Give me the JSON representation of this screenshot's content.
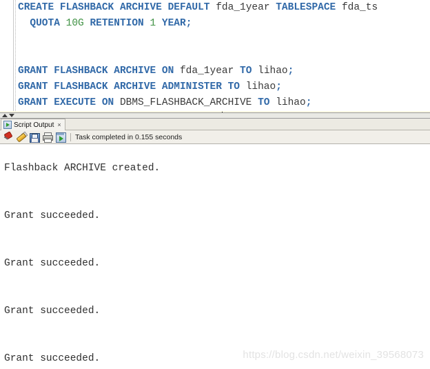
{
  "editor": {
    "lines": [
      {
        "current": false,
        "tokens": [
          {
            "t": "CREATE",
            "k": "kw"
          },
          {
            "t": " ",
            "k": "ws"
          },
          {
            "t": "FLASHBACK",
            "k": "kw"
          },
          {
            "t": " ",
            "k": "ws"
          },
          {
            "t": "ARCHIVE",
            "k": "kw"
          },
          {
            "t": " ",
            "k": "ws"
          },
          {
            "t": "DEFAULT",
            "k": "kw"
          },
          {
            "t": " ",
            "k": "ws"
          },
          {
            "t": "fda_1year",
            "k": "id"
          },
          {
            "t": " ",
            "k": "ws"
          },
          {
            "t": "TABLESPACE",
            "k": "kw"
          },
          {
            "t": " ",
            "k": "ws"
          },
          {
            "t": "fda_ts",
            "k": "id"
          }
        ]
      },
      {
        "current": false,
        "tokens": [
          {
            "t": "  ",
            "k": "ws"
          },
          {
            "t": "QUOTA",
            "k": "kw"
          },
          {
            "t": " ",
            "k": "ws"
          },
          {
            "t": "10G",
            "k": "num"
          },
          {
            "t": " ",
            "k": "ws"
          },
          {
            "t": "RETENTION",
            "k": "kw"
          },
          {
            "t": " ",
            "k": "ws"
          },
          {
            "t": "1",
            "k": "num"
          },
          {
            "t": " ",
            "k": "ws"
          },
          {
            "t": "YEAR",
            "k": "kw"
          },
          {
            "t": ";",
            "k": "punc"
          }
        ]
      },
      {
        "current": false,
        "tokens": []
      },
      {
        "current": false,
        "tokens": []
      },
      {
        "current": false,
        "tokens": [
          {
            "t": "GRANT",
            "k": "kw"
          },
          {
            "t": " ",
            "k": "ws"
          },
          {
            "t": "FLASHBACK",
            "k": "kw"
          },
          {
            "t": " ",
            "k": "ws"
          },
          {
            "t": "ARCHIVE",
            "k": "kw"
          },
          {
            "t": " ",
            "k": "ws"
          },
          {
            "t": "ON",
            "k": "kw"
          },
          {
            "t": " ",
            "k": "ws"
          },
          {
            "t": "fda_1year",
            "k": "id"
          },
          {
            "t": " ",
            "k": "ws"
          },
          {
            "t": "TO",
            "k": "kw"
          },
          {
            "t": " ",
            "k": "ws"
          },
          {
            "t": "lihao",
            "k": "id"
          },
          {
            "t": ";",
            "k": "punc"
          }
        ]
      },
      {
        "current": false,
        "tokens": [
          {
            "t": "GRANT",
            "k": "kw"
          },
          {
            "t": " ",
            "k": "ws"
          },
          {
            "t": "FLASHBACK",
            "k": "kw"
          },
          {
            "t": " ",
            "k": "ws"
          },
          {
            "t": "ARCHIVE",
            "k": "kw"
          },
          {
            "t": " ",
            "k": "ws"
          },
          {
            "t": "ADMINISTER",
            "k": "kw"
          },
          {
            "t": " ",
            "k": "ws"
          },
          {
            "t": "TO",
            "k": "kw"
          },
          {
            "t": " ",
            "k": "ws"
          },
          {
            "t": "lihao",
            "k": "id"
          },
          {
            "t": ";",
            "k": "punc"
          }
        ]
      },
      {
        "current": false,
        "tokens": [
          {
            "t": "GRANT",
            "k": "kw"
          },
          {
            "t": " ",
            "k": "ws"
          },
          {
            "t": "EXECUTE",
            "k": "kw"
          },
          {
            "t": " ",
            "k": "ws"
          },
          {
            "t": "ON",
            "k": "kw"
          },
          {
            "t": " ",
            "k": "ws"
          },
          {
            "t": "DBMS_FLASHBACK_ARCHIVE",
            "k": "id"
          },
          {
            "t": " ",
            "k": "ws"
          },
          {
            "t": "TO",
            "k": "kw"
          },
          {
            "t": " ",
            "k": "ws"
          },
          {
            "t": "lihao",
            "k": "id"
          },
          {
            "t": ";",
            "k": "punc"
          }
        ]
      },
      {
        "current": true,
        "tokens": [
          {
            "t": "GRANT",
            "k": "sel"
          },
          {
            "t": " ",
            "k": "ws"
          },
          {
            "t": "CREATE",
            "k": "kw"
          },
          {
            "t": " ",
            "k": "ws"
          },
          {
            "t": "ANY",
            "k": "kw"
          },
          {
            "t": " ",
            "k": "ws"
          },
          {
            "t": "CONTEXT",
            "k": "kw"
          },
          {
            "t": " ",
            "k": "ws"
          },
          {
            "t": "TO",
            "k": "kw"
          },
          {
            "t": " ",
            "k": "ws"
          },
          {
            "t": "lihao",
            "k": "id"
          },
          {
            "t": ";",
            "k": "match"
          },
          {
            "t": "",
            "k": "caret"
          }
        ]
      }
    ],
    "colors": {
      "keyword": "#3169a8",
      "number": "#3f9143",
      "identifier": "#3a3a3a",
      "selection": "#a8cdf0",
      "current_line": "#fdf9e3"
    }
  },
  "splitter": {
    "collapse_up_icon": "triangle-up-icon",
    "collapse_down_icon": "triangle-down-icon"
  },
  "output_panel": {
    "tab": {
      "label": "Script Output",
      "icon": "run-script-icon",
      "close_label": "×"
    },
    "toolbar": {
      "buttons": [
        {
          "name": "pin-button",
          "icon": "pin-icon",
          "title": "Pin"
        },
        {
          "name": "clear-button",
          "icon": "eraser-icon",
          "title": "Clear"
        },
        {
          "name": "save-button",
          "icon": "floppy-disk-icon",
          "title": "Save"
        },
        {
          "name": "print-button",
          "icon": "printer-icon",
          "title": "Print"
        },
        {
          "name": "run-script-button",
          "icon": "run-script-icon",
          "title": "Run Script"
        }
      ],
      "status": "Task completed in 0.155 seconds"
    },
    "output_lines": [
      "",
      "Flashback ARCHIVE created.",
      "",
      "",
      "Grant succeeded.",
      "",
      "",
      "Grant succeeded.",
      "",
      "",
      "Grant succeeded.",
      "",
      "",
      "Grant succeeded."
    ]
  },
  "watermark": {
    "text": "https://blog.csdn.net/weixin_39568073"
  }
}
